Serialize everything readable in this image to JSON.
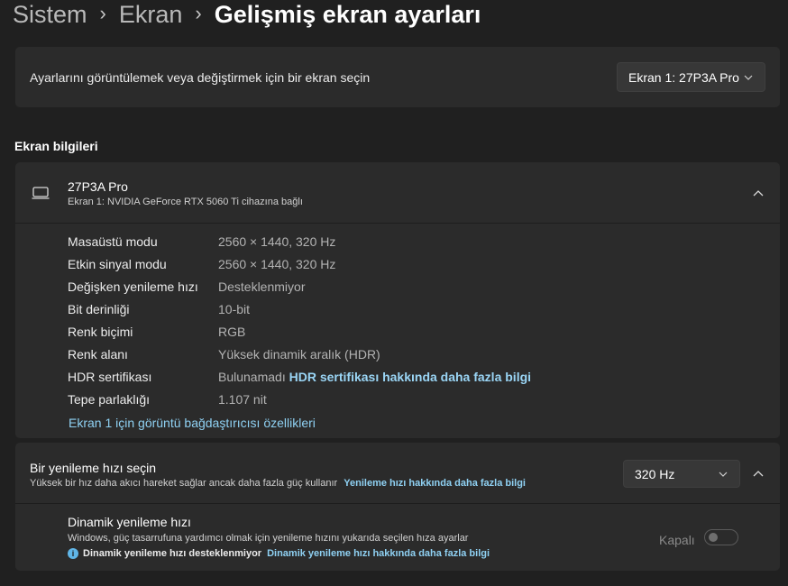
{
  "breadcrumb": {
    "items": [
      "Sistem",
      "Ekran"
    ],
    "current": "Gelişmiş ekran ayarları"
  },
  "display_select": {
    "label": "Ayarlarını görüntülemek veya değiştirmek için bir ekran seçin",
    "value": "Ekran 1: 27P3A Pro"
  },
  "info": {
    "section_title": "Ekran bilgileri",
    "monitor_name": "27P3A Pro",
    "monitor_sub": "Ekran 1: NVIDIA GeForce RTX 5060 Ti cihazına bağlı",
    "rows": [
      {
        "key": "Masaüstü modu",
        "value": "2560 × 1440, 320 Hz"
      },
      {
        "key": "Etkin sinyal modu",
        "value": "2560 × 1440, 320 Hz"
      },
      {
        "key": "Değişken yenileme hızı",
        "value": "Desteklenmiyor"
      },
      {
        "key": "Bit derinliği",
        "value": "10-bit"
      },
      {
        "key": "Renk biçimi",
        "value": "RGB"
      },
      {
        "key": "Renk alanı",
        "value": "Yüksek dinamik aralık (HDR)"
      },
      {
        "key": "HDR sertifikası",
        "value": "Bulunamadı",
        "link": "HDR sertifikası hakkında daha fazla bilgi"
      },
      {
        "key": "Tepe parlaklığı",
        "value": "1.107 nit"
      }
    ],
    "adapter_link": "Ekran 1 için görüntü bağdaştırıcısı özellikleri"
  },
  "refresh": {
    "title": "Bir yenileme hızı seçin",
    "desc": "Yüksek bir hız daha akıcı hareket sağlar ancak daha fazla güç kullanır",
    "desc_link": "Yenileme hızı hakkında daha fazla bilgi",
    "value": "320 Hz",
    "dynamic": {
      "title": "Dinamik yenileme hızı",
      "desc": "Windows, güç tasarrufuna yardımcı olmak için yenileme hızını yukarıda seçilen hıza ayarlar",
      "note_icon": "i",
      "note": "Dinamik yenileme hızı desteklenmiyor",
      "note_link": "Dinamik yenileme hızı hakkında daha fazla bilgi",
      "toggle_label": "Kapalı",
      "toggle_state": "off"
    }
  },
  "colors": {
    "background": "#202020",
    "card": "#2b2b2b",
    "link": "#8fd1f3"
  }
}
